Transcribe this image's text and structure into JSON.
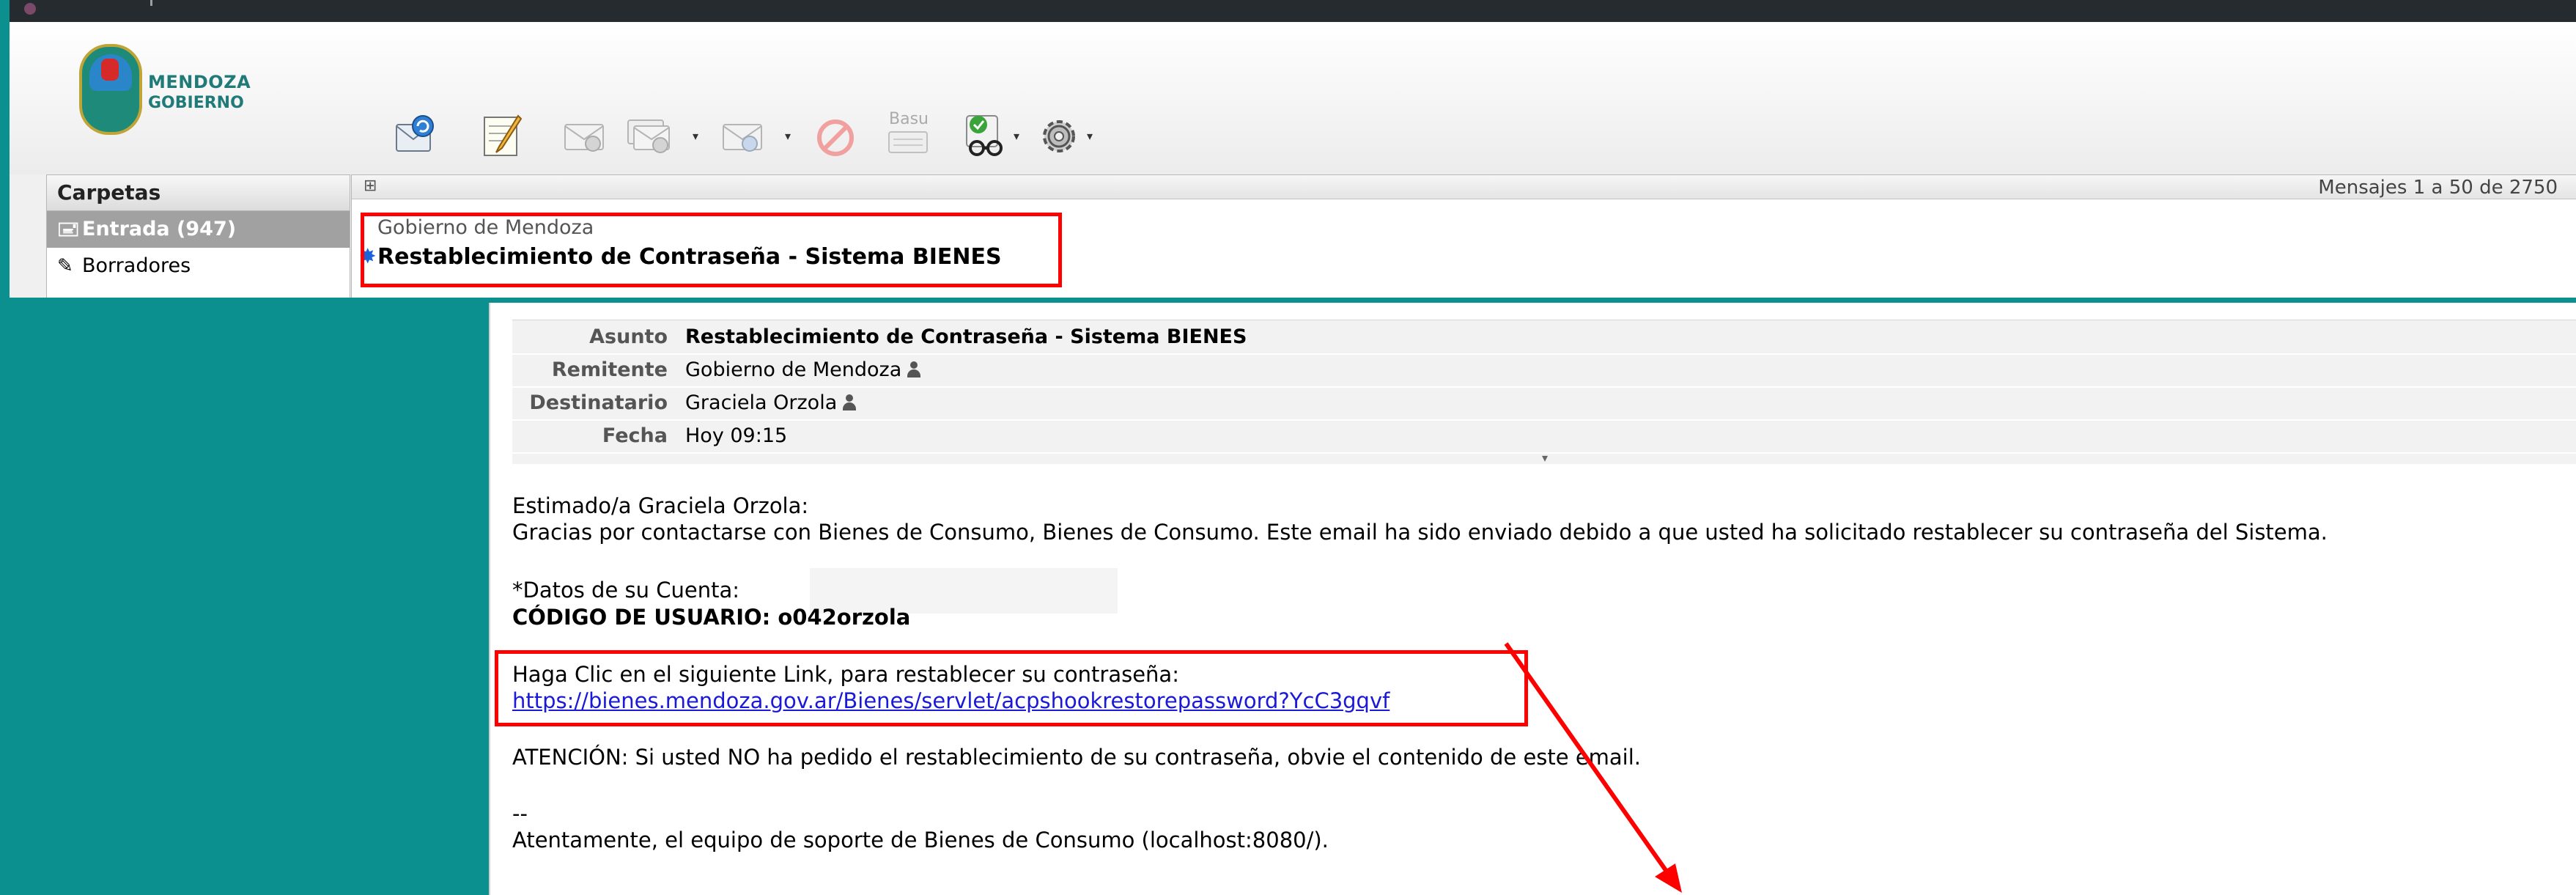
{
  "header": {
    "brand_line1": "MENDOZA",
    "brand_line2": "GOBIERNO",
    "colors": {
      "accent": "#1f7a78",
      "highlight": "#ff0000",
      "background": "#0b8f8f"
    }
  },
  "toolbar": {
    "buttons": [
      {
        "icon": "refresh-mail-icon"
      },
      {
        "icon": "compose-icon"
      },
      {
        "icon": "reply-icon"
      },
      {
        "icon": "reply-all-icon"
      },
      {
        "icon": "forward-icon"
      },
      {
        "icon": "delete-icon"
      },
      {
        "icon": "spam-icon",
        "label": "Basu"
      },
      {
        "icon": "mark-icon"
      },
      {
        "icon": "settings-icon"
      }
    ]
  },
  "sidebar": {
    "title": "Carpetas",
    "items": [
      {
        "label": "Entrada (947)",
        "icon": "inbox-icon",
        "active": true
      },
      {
        "label": "Borradores",
        "icon": "pencil-icon"
      }
    ]
  },
  "message_list": {
    "count_text": "Mensajes 1 a 50 de 2750",
    "row": {
      "sender": "Gobierno de Mendoza",
      "subject": "Restablecimiento de Contraseña - Sistema BIENES"
    }
  },
  "message": {
    "headers": [
      {
        "label": "Asunto",
        "value": "Restablecimiento de Contraseña - Sistema BIENES"
      },
      {
        "label": "Remitente",
        "value": "Gobierno de Mendoza"
      },
      {
        "label": "Destinatario",
        "value": "Graciela Orzola"
      },
      {
        "label": "Fecha",
        "value": "Hoy 09:15"
      }
    ],
    "body": {
      "greeting": "Estimado/a Graciela Orzola:",
      "line1": "Gracias por contactarse con Bienes de Consumo, Bienes de Consumo. Este email ha sido enviado debido a que usted ha solicitado restablecer su contraseña del Sistema.",
      "account_label": "*Datos de su Cuenta:",
      "user_code": "CÓDIGO DE USUARIO: o042orzola",
      "link_intro": "Haga Clic en el siguiente Link, para restablecer su contraseña:",
      "link": "https://bienes.mendoza.gov.ar/Bienes/servlet/acpshookrestorepassword?YcC3gqvf",
      "warning": "ATENCIÓN: Si usted NO ha pedido el restablecimiento de su contraseña, obvie el contenido de este email.",
      "separator": "--",
      "signature": "Atentamente, el equipo de soporte de Bienes de Consumo (localhost:8080/)."
    }
  }
}
